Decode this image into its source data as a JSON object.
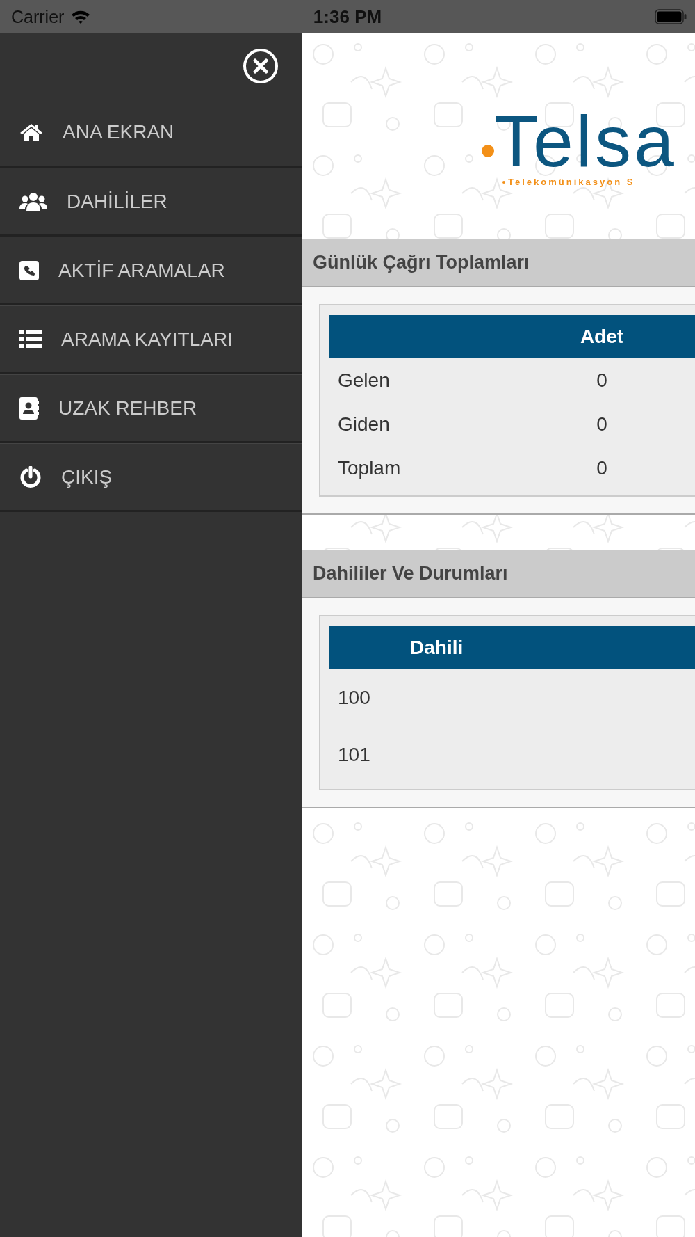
{
  "status_bar": {
    "carrier": "Carrier",
    "time": "1:36 PM"
  },
  "sidebar": {
    "items": [
      {
        "label": "ANA EKRAN",
        "kind": "home"
      },
      {
        "label": "DAHİLİLER",
        "kind": "users"
      },
      {
        "label": "AKTİF ARAMALAR",
        "kind": "phone"
      },
      {
        "label": "ARAMA KAYITLARI",
        "kind": "list"
      },
      {
        "label": "UZAK REHBER",
        "kind": "contacts"
      },
      {
        "label": "ÇIKIŞ",
        "kind": "power"
      }
    ]
  },
  "logo": {
    "name": "Telsa",
    "tagline": "Telekomünikasyon S"
  },
  "sections": [
    {
      "title": "Günlük Çağrı Toplamları",
      "kind": "totals",
      "header": "Adet",
      "rows": [
        [
          "Gelen",
          "0"
        ],
        [
          "Giden",
          "0"
        ],
        [
          "Toplam",
          "0"
        ]
      ]
    },
    {
      "title": "Dahililer Ve Durumları",
      "kind": "extensions",
      "header": "Dahili",
      "rows": [
        [
          "100"
        ],
        [
          "101"
        ]
      ]
    }
  ]
}
